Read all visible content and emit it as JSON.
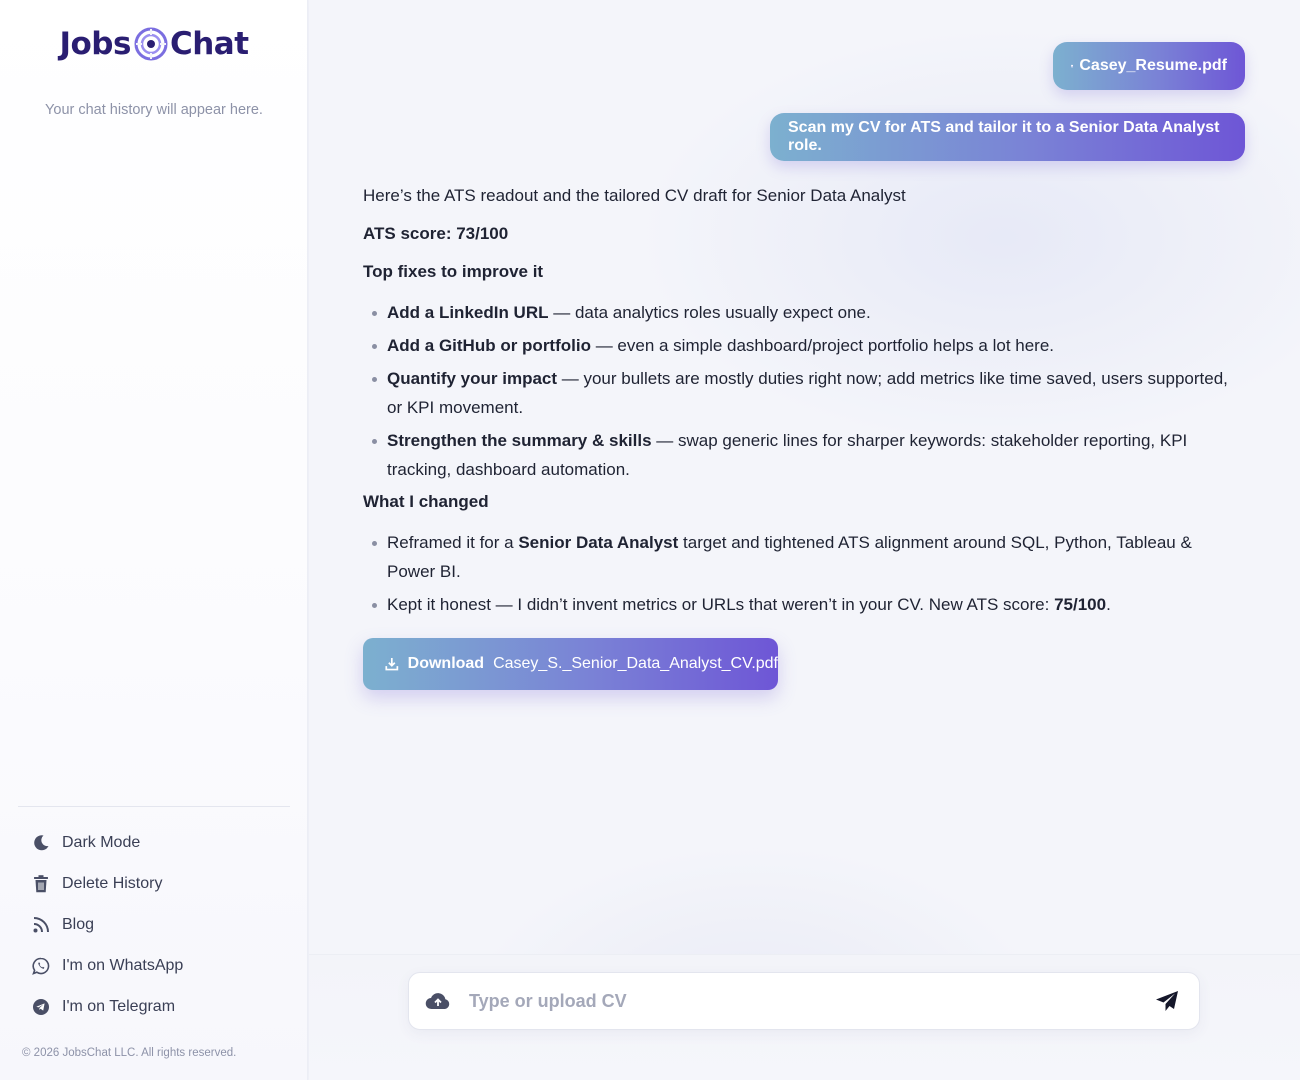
{
  "brand": {
    "name_left": "Jobs",
    "name_right": "Chat",
    "logo_color": "#2a1e72",
    "mark_color": "#7b6ee0"
  },
  "sidebar": {
    "history_empty": "Your chat history will appear here.",
    "menu": [
      {
        "label": "Dark Mode",
        "icon": "moon-icon"
      },
      {
        "label": "Delete History",
        "icon": "trash-icon"
      },
      {
        "label": "Blog",
        "icon": "rss-icon"
      },
      {
        "label": "I'm on WhatsApp",
        "icon": "whatsapp-icon"
      },
      {
        "label": "I'm on Telegram",
        "icon": "telegram-icon"
      }
    ],
    "copyright": "© 2026 JobsChat LLC. All rights reserved."
  },
  "chat": {
    "user_file": {
      "name": "Casey_Resume.pdf",
      "icon": "pdf-file-icon"
    },
    "user_message": "Scan my CV for ATS and tailor it to a Senior Data Analyst role.",
    "assistant": {
      "intro": "Here’s the ATS readout and the tailored CV draft for Senior Data Analyst",
      "ats_score": "ATS score: 73/100",
      "fixes_heading": "Top fixes to improve it",
      "fixes": [
        {
          "bold": "Add a LinkedIn URL",
          "text": " — data analytics roles usually expect one."
        },
        {
          "bold": "Add a GitHub or portfolio",
          "text": " — even a simple dashboard/project portfolio helps a lot here."
        },
        {
          "bold": "Quantify your impact",
          "text": " — your bullets are mostly duties right now; add metrics like time saved, users supported, or KPI movement."
        },
        {
          "bold": "Strengthen the summary & skills",
          "text": " — swap generic lines for sharper keywords: stakeholder reporting, KPI tracking, dashboard automation."
        }
      ],
      "changes_heading": "What I changed",
      "change_1": {
        "pre": "Reframed it for a ",
        "bold": "Senior Data Analyst",
        "post": " target and tightened ATS alignment around SQL, Python, Tableau & Power BI."
      },
      "change_2": {
        "pre": "Kept it honest — I didn’t invent metrics or URLs that weren’t in your CV. New ATS score: ",
        "bold": "75/100",
        "post": "."
      }
    },
    "download": {
      "label": "Download",
      "filename": "Casey_S._Senior_Data_Analyst_CV.pdf",
      "icon": "download-icon"
    }
  },
  "composer": {
    "placeholder": "Type or upload CV",
    "value": "",
    "upload_icon": "cloud-upload-icon",
    "send_icon": "send-icon"
  },
  "colors": {
    "accent_start": "#7cb0cf",
    "accent_end": "#6e56d6",
    "text": "#1f2333",
    "muted": "#8d92a8"
  }
}
